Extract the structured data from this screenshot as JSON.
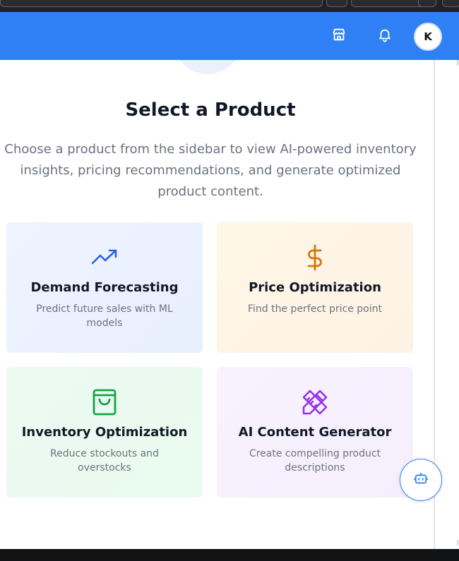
{
  "header": {
    "avatar_initial": "K",
    "brand_color": "#2f80f5"
  },
  "main": {
    "title": "Select a Product",
    "subtitle": "Choose a product from the sidebar to view AI-powered inventory insights, pricing recommendations, and generate optimized product content."
  },
  "cards": [
    {
      "title": "Demand Forecasting",
      "desc": "Predict future sales with ML models",
      "icon": "trending-up-icon",
      "color": "#2563eb"
    },
    {
      "title": "Price Optimization",
      "desc": "Find the perfect price point",
      "icon": "dollar-icon",
      "color": "#d97706"
    },
    {
      "title": "Inventory Optimization",
      "desc": "Reduce stockouts and overstocks",
      "icon": "shopping-bag-icon",
      "color": "#16a34a"
    },
    {
      "title": "AI Content Generator",
      "desc": "Create compelling product descriptions",
      "icon": "pencil-ruler-icon",
      "color": "#9333ea"
    }
  ],
  "assistant": {
    "icon": "bot-icon"
  }
}
